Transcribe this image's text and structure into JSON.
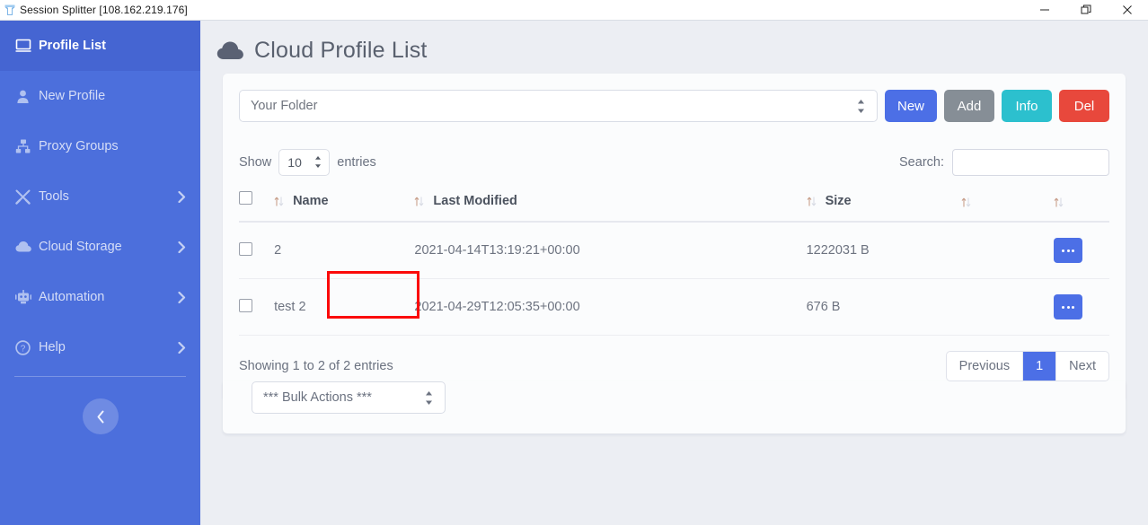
{
  "window": {
    "title": "Session Splitter [108.162.219.176]",
    "app_icon": "splitter-icon",
    "minimize_label": "—",
    "restore_label": "❐",
    "close_label": "✕"
  },
  "sidebar": {
    "items": [
      {
        "label": "Profile List",
        "icon": "monitor-icon",
        "active": true,
        "caret": false
      },
      {
        "label": "New Profile",
        "icon": "user-icon",
        "active": false,
        "caret": false
      },
      {
        "label": "Proxy Groups",
        "icon": "sitemap-icon",
        "active": false,
        "caret": false
      },
      {
        "label": "Tools",
        "icon": "tools-icon",
        "active": false,
        "caret": true
      },
      {
        "label": "Cloud Storage",
        "icon": "cloud-icon",
        "active": false,
        "caret": true
      },
      {
        "label": "Automation",
        "icon": "robot-icon",
        "active": false,
        "caret": true
      },
      {
        "label": "Help",
        "icon": "question-icon",
        "active": false,
        "caret": true
      }
    ],
    "collapse_icon": "chevron-left-icon",
    "background": "#4c6fdc"
  },
  "page": {
    "title": "Cloud Profile List",
    "title_icon": "cloud-icon"
  },
  "folder_bar": {
    "selected_folder": "Your Folder",
    "buttons": [
      {
        "label": "New",
        "color": "#4c6fe6"
      },
      {
        "label": "Add",
        "color": "#868e96"
      },
      {
        "label": "Info",
        "color": "#2cc0ce"
      },
      {
        "label": "Del",
        "color": "#e8483c"
      }
    ]
  },
  "controls": {
    "show_label": "Show",
    "entries_label": "entries",
    "page_length": "10",
    "search_label": "Search:",
    "search_value": "",
    "search_placeholder": ""
  },
  "table": {
    "columns": [
      {
        "label": "",
        "sortable": false,
        "type": "checkbox"
      },
      {
        "label": "Name",
        "sortable": true,
        "type": "text"
      },
      {
        "label": "Last Modified",
        "sortable": true,
        "type": "text"
      },
      {
        "label": "Size",
        "sortable": true,
        "type": "text"
      },
      {
        "label": "",
        "sortable": true,
        "type": "text"
      },
      {
        "label": "",
        "sortable": true,
        "type": "actions"
      }
    ],
    "rows": [
      {
        "name": "2",
        "last_modified": "2021-04-14T13:19:21+00:00",
        "size": "1222031 B",
        "checked": false,
        "action_icon": "ellipsis-icon"
      },
      {
        "name": "test 2",
        "last_modified": "2021-04-29T12:05:35+00:00",
        "size": "676 B",
        "checked": false,
        "action_icon": "ellipsis-icon"
      }
    ]
  },
  "footer": {
    "showing": "Showing 1 to 2 of 2 entries",
    "pagination": {
      "previous": "Previous",
      "pages": [
        "1"
      ],
      "next": "Next",
      "active_page": "1"
    }
  },
  "bulk": {
    "selected": "*** Bulk Actions ***"
  },
  "annotation": {
    "target": "test 2",
    "color": "#fb0a0a"
  }
}
